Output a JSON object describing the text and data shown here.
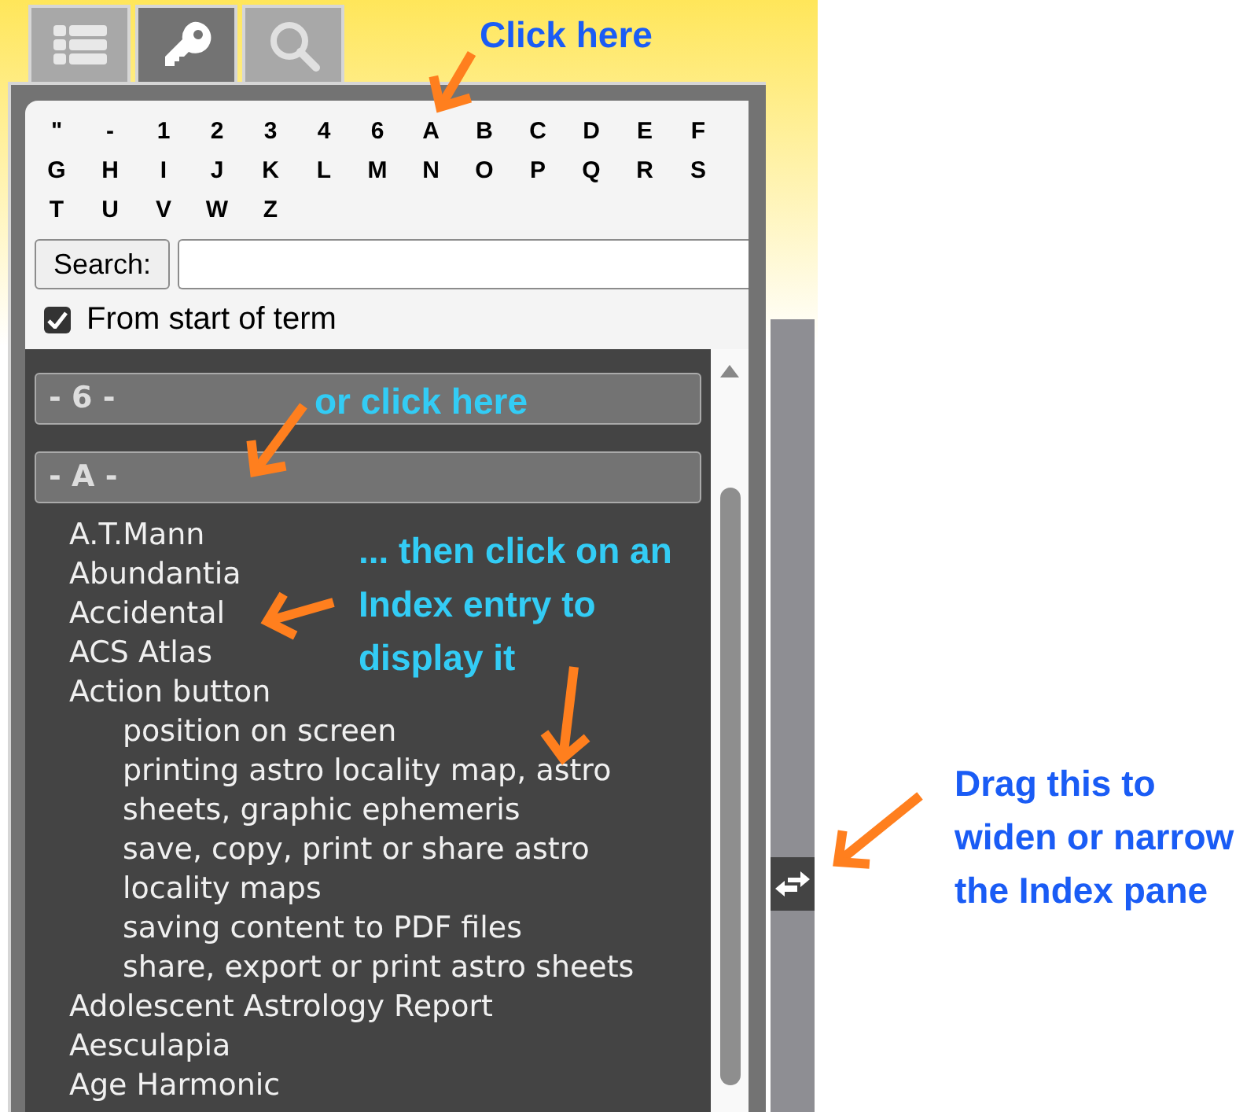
{
  "tabs": [
    {
      "kind": "list",
      "selected": false
    },
    {
      "kind": "key",
      "selected": true
    },
    {
      "kind": "search",
      "selected": false
    }
  ],
  "letters": [
    "\"",
    "-",
    "1",
    "2",
    "3",
    "4",
    "6",
    "A",
    "B",
    "C",
    "D",
    "E",
    "F",
    "G",
    "H",
    "I",
    "J",
    "K",
    "L",
    "M",
    "N",
    "O",
    "P",
    "Q",
    "R",
    "S",
    "T",
    "U",
    "V",
    "W",
    "Z"
  ],
  "search": {
    "button": "Search:"
  },
  "from_start": {
    "label": "From start of term",
    "checked": true
  },
  "sections": [
    {
      "heading": "- 6 -"
    },
    {
      "heading": "- A -",
      "entries": [
        {
          "text": "A.T.Mann"
        },
        {
          "text": "Abundantia"
        },
        {
          "text": "Accidental"
        },
        {
          "text": "ACS Atlas"
        },
        {
          "text": "Action button",
          "children": [
            {
              "text": "position on screen"
            },
            {
              "text": "printing astro locality map, astro sheets, graphic ephemeris"
            },
            {
              "text": "save, copy, print or share astro locality maps"
            },
            {
              "text": "saving content to PDF files"
            },
            {
              "text": "share, export or print astro sheets"
            }
          ]
        },
        {
          "text": "Adolescent Astrology Report"
        },
        {
          "text": "Aesculapia"
        },
        {
          "text": "Age Harmonic"
        }
      ]
    }
  ],
  "annotations": [
    {
      "lines": [
        "Click here"
      ],
      "color": "#1a5cf5"
    },
    {
      "lines": [
        "or click here"
      ],
      "color": "#33ccf5"
    },
    {
      "lines": [
        "... then click on an",
        "Index entry to",
        "display it"
      ],
      "color": "#33ccf5"
    },
    {
      "lines": [
        "Drag this to",
        "widen or narrow",
        "the Index pane"
      ],
      "color": "#1a5cf5"
    }
  ]
}
